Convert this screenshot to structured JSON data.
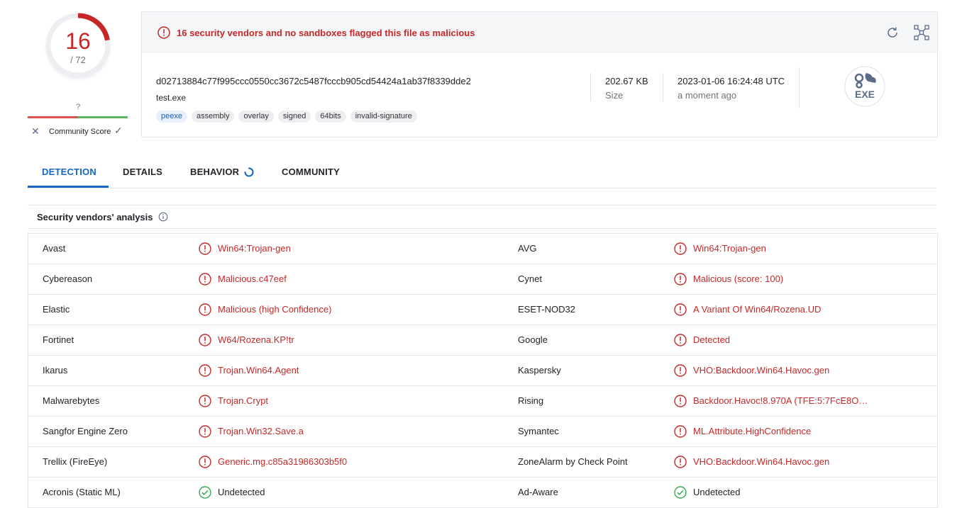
{
  "score": {
    "detections": "16",
    "total": "/ 72",
    "detection_ratio": 0.222,
    "color": "#c62828"
  },
  "community": {
    "question": "?",
    "label": "Community Score",
    "down_icon": "close-icon",
    "up_icon": "check-icon"
  },
  "banner": {
    "text": "16 security vendors and no sandboxes flagged this file as malicious",
    "icon": "alert-circle-icon",
    "color": "#c62828"
  },
  "toolbar": {
    "reload_icon": "reload-icon",
    "graph_icon": "graph-icon"
  },
  "file": {
    "hash": "d02713884c77f995ccc0550cc3672c5487fcccb905cd54424a1ab37f8339dde2",
    "name": "test.exe",
    "tags": [
      "peexe",
      "assembly",
      "overlay",
      "signed",
      "64bits",
      "invalid-signature"
    ],
    "size_value": "202.67 KB",
    "size_label": "Size",
    "date": "2023-01-06 16:24:48 UTC",
    "date_relative": "a moment ago",
    "type_icon_label": "EXE"
  },
  "tabs": [
    {
      "label": "DETECTION",
      "active": true
    },
    {
      "label": "DETAILS",
      "active": false
    },
    {
      "label": "BEHAVIOR",
      "active": false
    },
    {
      "label": "COMMUNITY",
      "active": false
    }
  ],
  "section": {
    "title": "Security vendors' analysis"
  },
  "vendors": [
    {
      "left": {
        "vendor": "Avast",
        "result": "Win64:Trojan-gen",
        "status": "malicious"
      },
      "right": {
        "vendor": "AVG",
        "result": "Win64:Trojan-gen",
        "status": "malicious"
      }
    },
    {
      "left": {
        "vendor": "Cybereason",
        "result": "Malicious.c47eef",
        "status": "malicious"
      },
      "right": {
        "vendor": "Cynet",
        "result": "Malicious (score: 100)",
        "status": "malicious"
      }
    },
    {
      "left": {
        "vendor": "Elastic",
        "result": "Malicious (high Confidence)",
        "status": "malicious"
      },
      "right": {
        "vendor": "ESET-NOD32",
        "result": "A Variant Of Win64/Rozena.UD",
        "status": "malicious"
      }
    },
    {
      "left": {
        "vendor": "Fortinet",
        "result": "W64/Rozena.KP!tr",
        "status": "malicious"
      },
      "right": {
        "vendor": "Google",
        "result": "Detected",
        "status": "malicious"
      }
    },
    {
      "left": {
        "vendor": "Ikarus",
        "result": "Trojan.Win64.Agent",
        "status": "malicious"
      },
      "right": {
        "vendor": "Kaspersky",
        "result": "VHO:Backdoor.Win64.Havoc.gen",
        "status": "malicious"
      }
    },
    {
      "left": {
        "vendor": "Malwarebytes",
        "result": "Trojan.Crypt",
        "status": "malicious"
      },
      "right": {
        "vendor": "Rising",
        "result": "Backdoor.Havoc!8.970A (TFE:5:7FcE8O…",
        "status": "malicious"
      }
    },
    {
      "left": {
        "vendor": "Sangfor Engine Zero",
        "result": "Trojan.Win32.Save.a",
        "status": "malicious"
      },
      "right": {
        "vendor": "Symantec",
        "result": "ML.Attribute.HighConfidence",
        "status": "malicious"
      }
    },
    {
      "left": {
        "vendor": "Trellix (FireEye)",
        "result": "Generic.mg.c85a31986303b5f0",
        "status": "malicious"
      },
      "right": {
        "vendor": "ZoneAlarm by Check Point",
        "result": "VHO:Backdoor.Win64.Havoc.gen",
        "status": "malicious"
      }
    },
    {
      "left": {
        "vendor": "Acronis (Static ML)",
        "result": "Undetected",
        "status": "undetected"
      },
      "right": {
        "vendor": "Ad-Aware",
        "result": "Undetected",
        "status": "undetected"
      }
    }
  ]
}
